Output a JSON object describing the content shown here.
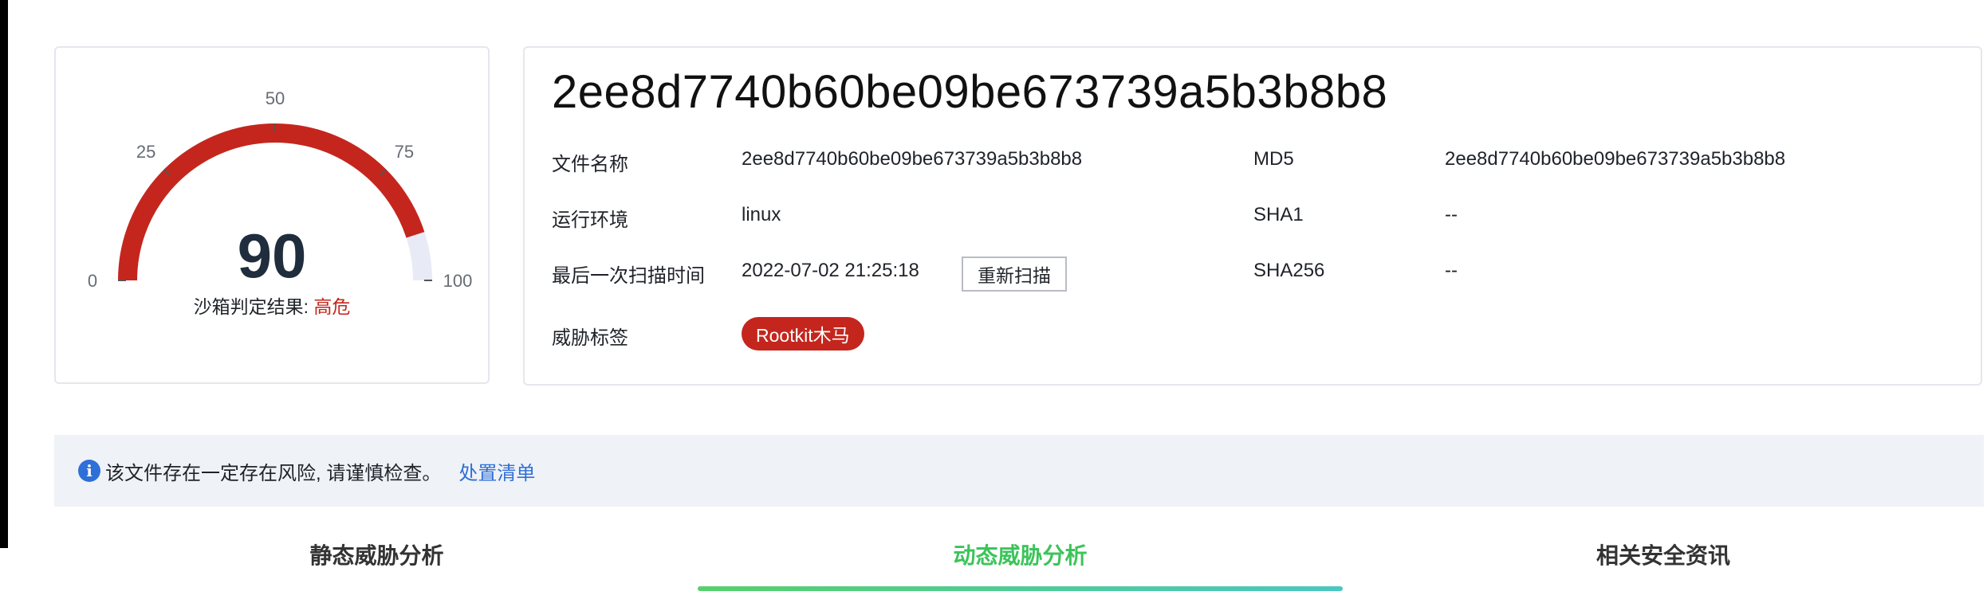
{
  "gauge": {
    "score": "90",
    "max": 100,
    "tick_labels": [
      "0",
      "25",
      "50",
      "75",
      "100"
    ],
    "verdict_label": "沙箱判定结果: ",
    "verdict_value": "高危",
    "fill_color": "#c4261d",
    "track_color": "#e8eaf6"
  },
  "file": {
    "hash_title": "2ee8d7740b60be09be673739a5b3b8b8",
    "labels": {
      "file_name": "文件名称",
      "environment": "运行环境",
      "last_scan": "最后一次扫描时间",
      "threat_tags": "威胁标签",
      "md5": "MD5",
      "sha1": "SHA1",
      "sha256": "SHA256"
    },
    "values": {
      "file_name": "2ee8d7740b60be09be673739a5b3b8b8",
      "environment": "linux",
      "last_scan": "2022-07-02 21:25:18",
      "md5": "2ee8d7740b60be09be673739a5b3b8b8",
      "sha1": "--",
      "sha256": "--"
    },
    "rescan_label": "重新扫描",
    "tags": [
      "Rootkit木马"
    ]
  },
  "alert": {
    "icon": "info-icon",
    "message": "该文件存在一定存在风险, 请谨慎检查。",
    "link": "处置清单"
  },
  "tabs": [
    {
      "label": "静态威胁分析",
      "active": false
    },
    {
      "label": "动态威胁分析",
      "active": true
    },
    {
      "label": "相关安全资讯",
      "active": false
    }
  ],
  "colors": {
    "danger": "#c4261d",
    "link": "#2f6fd8",
    "tab_active": "#3cc45a"
  }
}
